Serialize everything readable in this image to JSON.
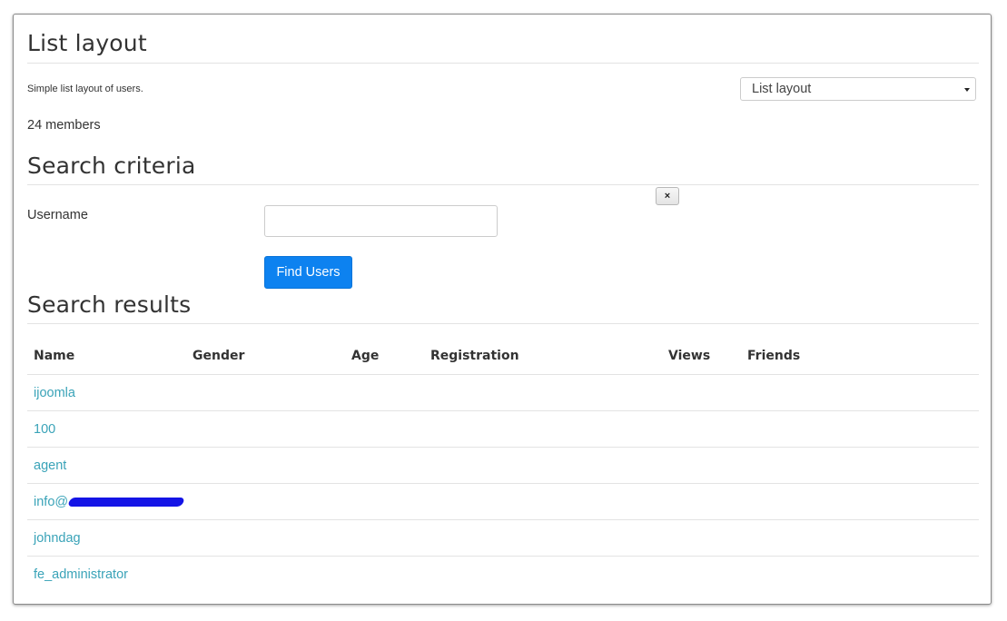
{
  "page": {
    "title": "List layout",
    "description": "Simple list layout of users.",
    "member_count": "24 members",
    "layout_select": {
      "selected": "List layout"
    }
  },
  "search": {
    "heading": "Search criteria",
    "close_label": "×",
    "username_label": "Username",
    "username_value": "",
    "username_placeholder": "",
    "find_button": "Find Users"
  },
  "results": {
    "heading": "Search results",
    "columns": [
      "Name",
      "Gender",
      "Age",
      "Registration",
      "Views",
      "Friends"
    ],
    "rows": [
      {
        "name": "ijoomla"
      },
      {
        "name": "100"
      },
      {
        "name": "agent"
      },
      {
        "name": "info@"
      },
      {
        "name": "johndag"
      },
      {
        "name": "fe_administrator"
      }
    ]
  },
  "colors": {
    "link": "#3aa3b8",
    "primary_button": "#0d82f0",
    "redaction": "#1414e6"
  }
}
